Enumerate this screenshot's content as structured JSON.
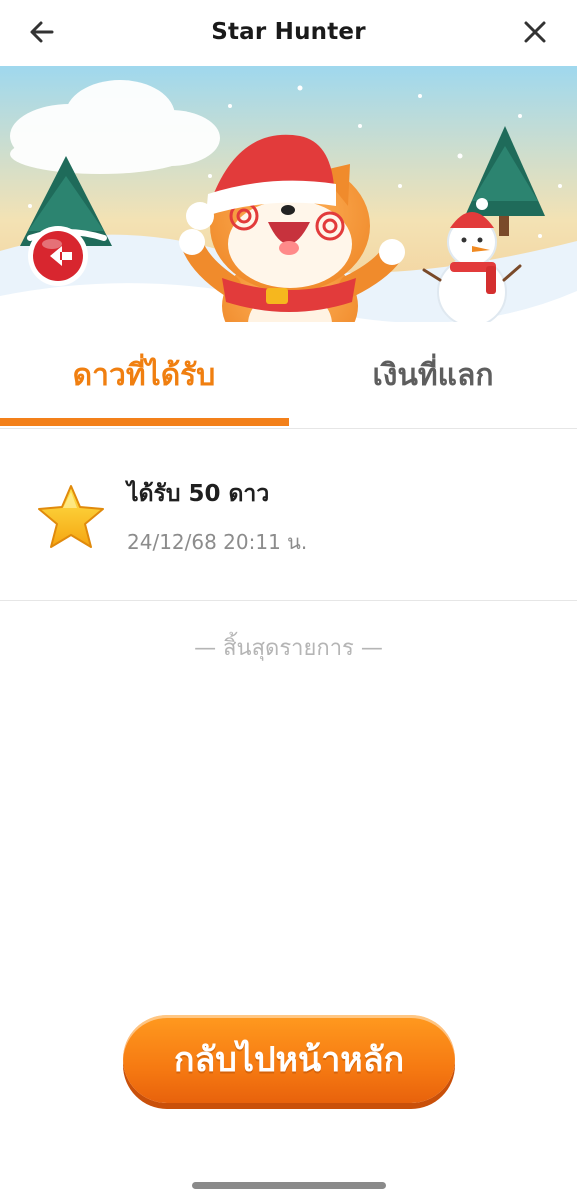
{
  "header": {
    "title": "Star Hunter",
    "back_icon": "arrow-left-icon",
    "close_icon": "close-icon"
  },
  "banner": {
    "back_icon": "red-circle-back-icon",
    "mascot": "shiba-dog-santa-hat-mascot",
    "scene": "snowy-winter-scene-with-pine-trees-and-snowman"
  },
  "tabs": [
    {
      "label": "ดาวที่ได้รับ",
      "active": true
    },
    {
      "label": "เงินที่แลก",
      "active": false
    }
  ],
  "records": [
    {
      "icon": "star-icon",
      "title": "ได้รับ 50 ดาว",
      "time": "24/12/68 20:11 น."
    }
  ],
  "end_of_list": "— สิ้นสุดรายการ —",
  "home_button": {
    "label": "กลับไปหน้าหลัก"
  },
  "colors": {
    "accent": "#f3801a",
    "tab_inactive": "#5e5e5e",
    "muted_text": "#8c8c8c",
    "end_text": "#b5b5b5"
  }
}
